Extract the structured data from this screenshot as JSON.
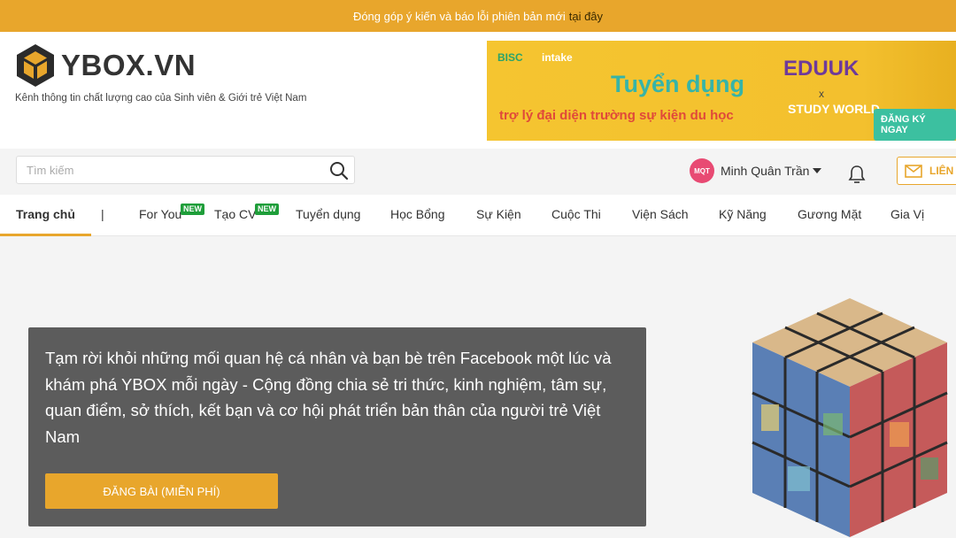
{
  "topbar": {
    "message": "Đóng góp ý kiến và báo lỗi phiên bản mới",
    "link": "tại đây"
  },
  "header": {
    "logo_text": "YBOX.VN",
    "tagline": "Kênh thông tin chất lượng cao của Sinh viên & Giới trẻ Việt Nam",
    "banner": {
      "brand1": "BISC",
      "brand2": "intake",
      "title": "Tuyển dụng",
      "subtitle": "trợ lý đại diện trường sự kiện du học",
      "partner1": "EDUUK",
      "x": "x",
      "partner2": "STUDY WORLD",
      "cta": "ĐĂNG KÝ NGAY"
    }
  },
  "search": {
    "placeholder": "Tìm kiếm"
  },
  "user": {
    "initials": "MQT",
    "name": "Minh Quân Trần"
  },
  "contact_label": "LIÊN H",
  "nav": {
    "items": [
      "Trang chủ",
      "|",
      "For You",
      "Tạo CV",
      "Tuyển dụng",
      "Học Bổng",
      "Sự Kiện",
      "Cuộc Thi",
      "Viện Sách",
      "Kỹ Năng",
      "Gương Mặt",
      "Gia Vị"
    ],
    "new_badge": "NEW"
  },
  "hero": {
    "text": "Tạm rời khỏi những mối quan hệ cá nhân và bạn bè trên Facebook một lúc và khám phá YBOX mỗi ngày - Cộng đồng chia sẻ tri thức, kinh nghiệm, tâm sự, quan điểm, sở thích, kết bạn và cơ hội phát triển bản thân của người trẻ Việt Nam",
    "button": "ĐĂNG BÀI (MIỄN PHÍ)"
  },
  "colors": {
    "accent": "#e8a62c",
    "panel": "#5c5c5c",
    "badge": "#1f9e3a",
    "avatar": "#e84a73"
  },
  "icons": [
    "logo-cube-icon",
    "search-icon",
    "bell-icon",
    "mail-icon",
    "caret-down-icon"
  ]
}
